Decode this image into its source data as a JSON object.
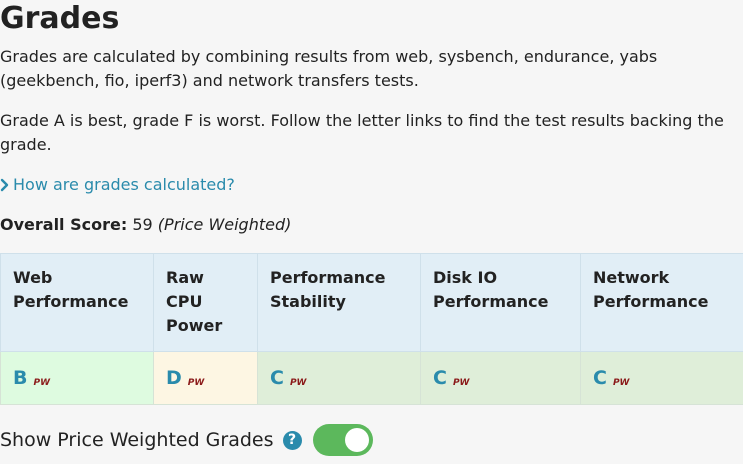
{
  "title": "Grades",
  "paragraphs": {
    "intro": "Grades are calculated by combining results from web, sysbench, endurance, yabs (geekbench, fio, iperf3) and network transfers tests.",
    "scale": "Grade A is best, grade F is worst. Follow the letter links to find the test results backing the grade."
  },
  "how_link": "How are grades calculated?",
  "overall": {
    "label": "Overall Score:",
    "value": "59",
    "note": "(Price Weighted)"
  },
  "table": {
    "headers": [
      "Web Performance",
      "Raw CPU Power",
      "Performance Stability",
      "Disk IO Performance",
      "Network Performance"
    ],
    "grades": [
      {
        "letter": "B",
        "tag": "PW",
        "color": "#defbe0"
      },
      {
        "letter": "D",
        "tag": "PW",
        "color": "#fdf6e3"
      },
      {
        "letter": "C",
        "tag": "PW",
        "color": "#dfeed9"
      },
      {
        "letter": "C",
        "tag": "PW",
        "color": "#dfeed9"
      },
      {
        "letter": "C",
        "tag": "PW",
        "color": "#dfeed9"
      }
    ]
  },
  "toggle": {
    "label": "Show Price Weighted Grades",
    "help_glyph": "?",
    "state": "on",
    "on_color": "#5cb85c"
  },
  "colors": {
    "link": "#2a8bac",
    "header_bg": "#e1eef6",
    "pw_tag": "#8b1a1a"
  },
  "icons": {
    "chevron": "chevron-right-icon",
    "help": "question-circle-icon"
  }
}
